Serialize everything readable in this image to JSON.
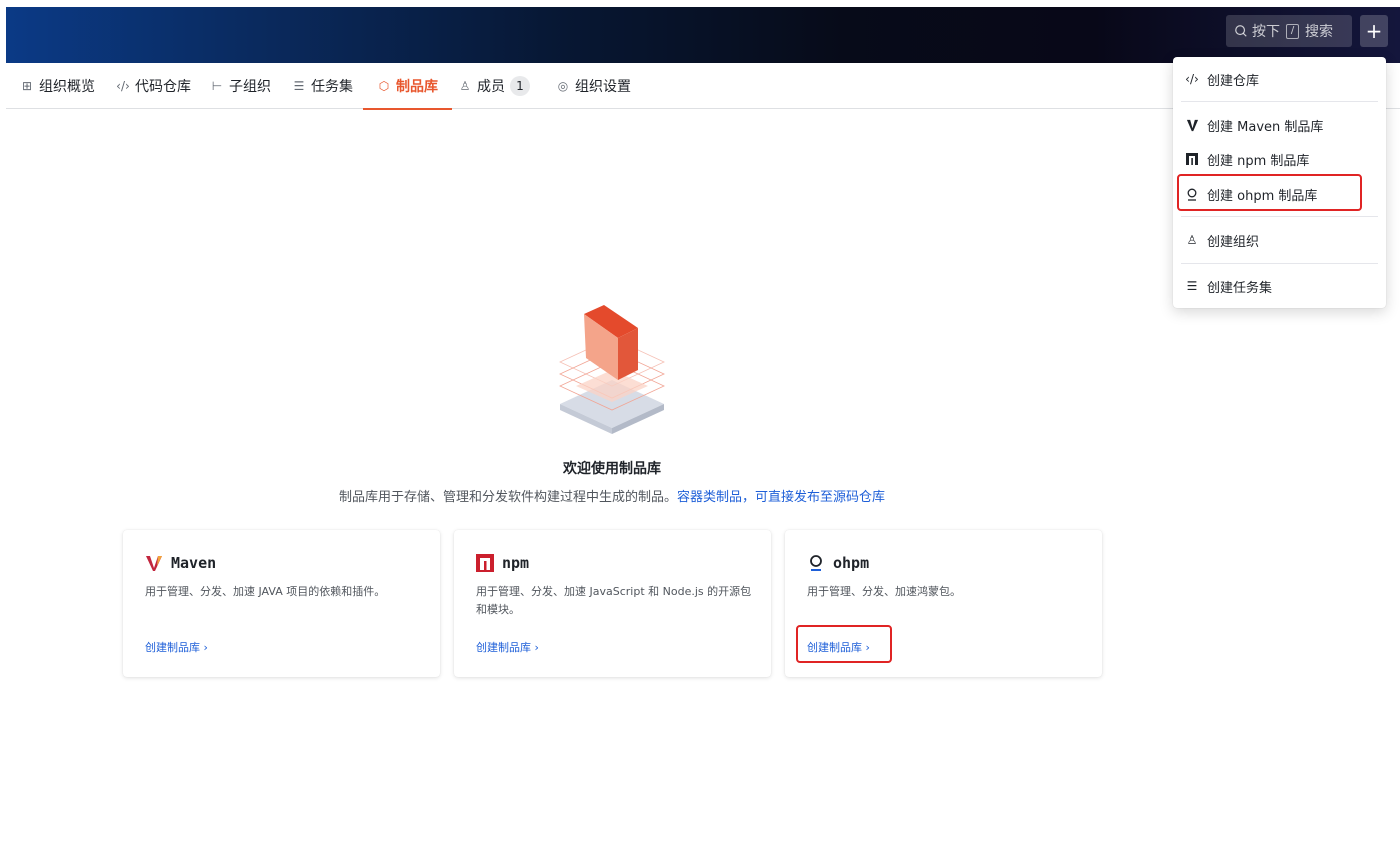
{
  "topbar": {
    "search_prefix": "按下",
    "search_key": "/",
    "search_suffix": "搜索",
    "add_label": "+"
  },
  "tabs": [
    {
      "label": "组织概览",
      "icon": "grid-icon"
    },
    {
      "label": "代码仓库",
      "icon": "code-icon"
    },
    {
      "label": "子组织",
      "icon": "tree-icon"
    },
    {
      "label": "任务集",
      "icon": "list-icon"
    },
    {
      "label": "制品库",
      "icon": "cube-icon",
      "active": true
    },
    {
      "label": "成员",
      "icon": "users-icon",
      "count": "1"
    },
    {
      "label": "组织设置",
      "icon": "settings-icon"
    }
  ],
  "welcome": {
    "title": "欢迎使用制品库",
    "desc": "制品库用于存储、管理和分发软件构建过程中生成的制品。",
    "link": "容器类制品，可直接发布至源码仓库"
  },
  "cards": [
    {
      "name": "Maven",
      "desc": "用于管理、分发、加速 JAVA 项目的依赖和插件。",
      "link": "创建制品库 ›"
    },
    {
      "name": "npm",
      "desc": "用于管理、分发、加速 JavaScript 和 Node.js 的开源包和模块。",
      "link": "创建制品库 ›"
    },
    {
      "name": "ohpm",
      "desc": "用于管理、分发、加速鸿蒙包。",
      "link": "创建制品库 ›"
    }
  ],
  "dropdown": {
    "items": [
      {
        "label": "创建仓库",
        "icon": "code-icon"
      },
      {
        "label": "创建 Maven 制品库",
        "icon": "maven-icon"
      },
      {
        "label": "创建 npm 制品库",
        "icon": "npm-icon"
      },
      {
        "label": "创建 ohpm 制品库",
        "icon": "ohpm-icon"
      },
      {
        "label": "创建组织",
        "icon": "users-icon"
      },
      {
        "label": "创建任务集",
        "icon": "list-icon"
      }
    ]
  },
  "colors": {
    "accent": "#e8572e",
    "link": "#1e5fd8",
    "highlight": "#e02424"
  }
}
